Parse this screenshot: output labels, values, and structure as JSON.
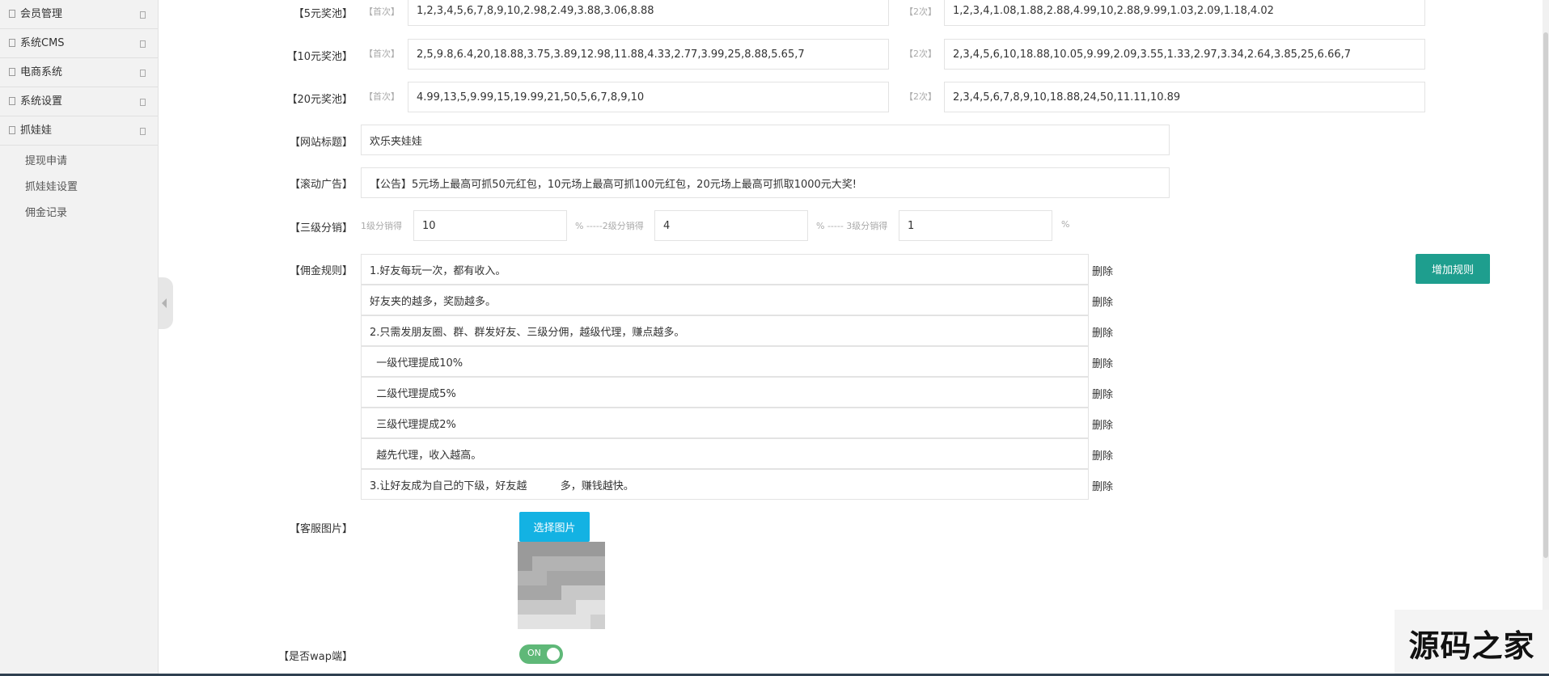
{
  "sidebar": {
    "menu": [
      {
        "label": "会员管理"
      },
      {
        "label": "系统CMS"
      },
      {
        "label": "电商系统"
      },
      {
        "label": "系统设置"
      },
      {
        "label": "抓娃娃"
      }
    ],
    "submenu": [
      {
        "label": "提现申请"
      },
      {
        "label": "抓娃娃设置"
      },
      {
        "label": "佣金记录"
      }
    ]
  },
  "form": {
    "pool5": {
      "label": "【5元奖池】",
      "first_tag": "【首次】",
      "first_value": "1,2,3,4,5,6,7,8,9,10,2.98,2.49,3.88,3.06,8.88",
      "second_tag": "【2次】",
      "second_value": "1,2,3,4,1.08,1.88,2.88,4.99,10,2.88,9.99,1.03,2.09,1.18,4.02"
    },
    "pool10": {
      "label": "【10元奖池】",
      "first_tag": "【首次】",
      "first_value": "2,5,9.8,6.4,20,18.88,3.75,3.89,12.98,11.88,4.33,2.77,3.99,25,8.88,5.65,7",
      "second_tag": "【2次】",
      "second_value": "2,3,4,5,6,10,18.88,10.05,9.99,2.09,3.55,1.33,2.97,3.34,2.64,3.85,25,6.66,7"
    },
    "pool20": {
      "label": "【20元奖池】",
      "first_tag": "【首次】",
      "first_value": "4.99,13,5,9.99,15,19.99,21,50,5,6,7,8,9,10",
      "second_tag": "【2次】",
      "second_value": "2,3,4,5,6,7,8,9,10,18.88,24,50,11.11,10.89"
    },
    "site_title": {
      "label": "【网站标题】",
      "value": "欢乐夹娃娃"
    },
    "marquee": {
      "label": "【滚动广告】",
      "value": "【公告】5元场上最高可抓50元红包，10元场上最高可抓100元红包，20元场上最高可抓取1000元大奖!"
    },
    "distribution": {
      "label": "【三级分销】",
      "level1_label": "1级分销得",
      "level1_value": "10",
      "level2_label": "% -----2级分销得",
      "level2_value": "4",
      "level3_label": "% ----- 3级分销得",
      "level3_value": "1",
      "percent": "%"
    },
    "commission": {
      "label": "【佣金规则】",
      "delete_label": "删除",
      "add_label": "增加规则",
      "rules": [
        "1.好友每玩一次，都有收入。",
        "好友夹的越多，奖励越多。",
        "2.只需发朋友圈、群、群发好友、三级分佣，越级代理，赚点越多。",
        "  一级代理提成10%",
        "  二级代理提成5%",
        "  三级代理提成2%",
        "  越先代理，收入越高。",
        "3.让好友成为自己的下级，好友越          多，赚钱越快。"
      ]
    },
    "service_image": {
      "label": "【客服图片】",
      "button": "选择图片"
    },
    "wap": {
      "label": "【是否wap端】",
      "toggle_text": "ON"
    }
  },
  "watermark": "源码之家",
  "colors": {
    "primary_teal": "#1e9e8e",
    "upload_blue": "#13b2e3",
    "toggle_green": "#5fb878"
  }
}
